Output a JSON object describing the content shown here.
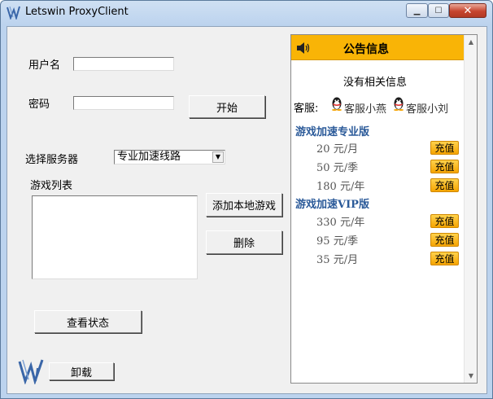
{
  "window": {
    "title": "Letswin ProxyClient"
  },
  "login": {
    "username_label": "用户名",
    "username_value": "",
    "password_label": "密码",
    "password_value": "",
    "start_button": "开始"
  },
  "server": {
    "label": "选择服务器",
    "selected": "专业加速线路"
  },
  "games": {
    "label": "游戏列表",
    "items": [],
    "add_button": "添加本地游戏",
    "delete_button": "删除"
  },
  "status_button": "查看状态",
  "uninstall_button": "卸载",
  "notice": {
    "title": "公告信息",
    "empty_message": "没有相关信息",
    "customer_service_label": "客服:",
    "agents": [
      "客服小燕",
      "客服小刘"
    ],
    "plans": [
      {
        "name": "游戏加速专业版",
        "prices": [
          {
            "amount": "20",
            "unit": "元/月"
          },
          {
            "amount": "50",
            "unit": "元/季"
          },
          {
            "amount": "180",
            "unit": "元/年"
          }
        ]
      },
      {
        "name": "游戏加速VIP版",
        "prices": [
          {
            "amount": "330",
            "unit": "元/年"
          },
          {
            "amount": "95",
            "unit": "元/季"
          },
          {
            "amount": "35",
            "unit": "元/月"
          }
        ]
      }
    ],
    "recharge_label": "充值"
  },
  "icons": {
    "speaker": "speaker-icon",
    "qq": "qq-penguin-icon",
    "logo": "letswin-logo"
  },
  "colors": {
    "accent": "#f9b406",
    "section_title": "#2b5a99",
    "recharge_button": "#f6a400"
  }
}
